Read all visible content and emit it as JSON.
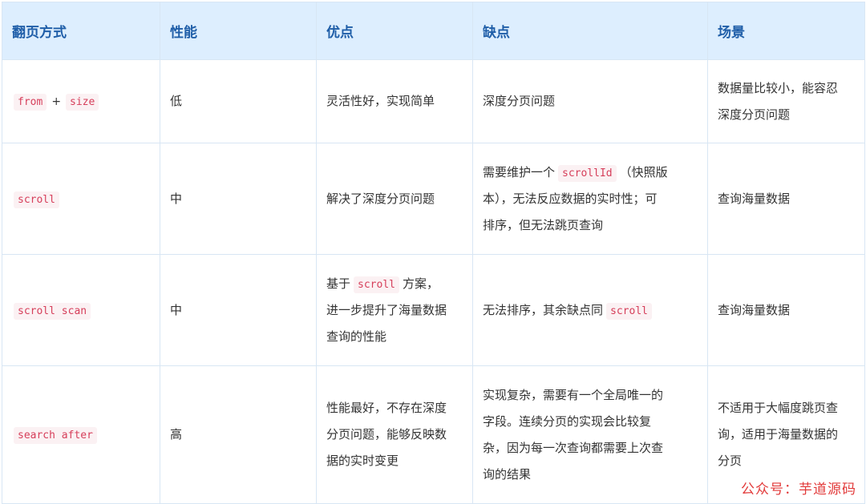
{
  "headers": [
    "翻页方式",
    "性能",
    "优点",
    "缺点",
    "场景"
  ],
  "rows": [
    {
      "method": [
        "from",
        "+",
        "size"
      ],
      "performance": "低",
      "pros": "灵活性好，实现简单",
      "cons": "深度分页问题",
      "scenario_line1": "数据量比较小，能容忍",
      "scenario_line2": "深度分页问题"
    },
    {
      "method": "scroll",
      "performance": "中",
      "pros": "解决了深度分页问题",
      "cons_line1_pre": "需要维护一个",
      "cons_code": "scrollId",
      "cons_line1_post": "（快照版",
      "cons_line2": "本），无法反应数据的实时性；可",
      "cons_line3": "排序，但无法跳页查询",
      "scenario": "查询海量数据"
    },
    {
      "method": "scroll scan",
      "performance": "中",
      "pros_pre": "基于",
      "pros_code": "scroll",
      "pros_post": "方案，",
      "pros_line2": "进一步提升了海量数据",
      "pros_line3": "查询的性能",
      "cons_pre": "无法排序，其余缺点同",
      "cons_code": "scroll",
      "scenario": "查询海量数据"
    },
    {
      "method": "search after",
      "performance": "高",
      "pros_line1": "性能最好，不存在深度",
      "pros_line2": "分页问题，能够反映数",
      "pros_line3": "据的实时变更",
      "cons_line1": "实现复杂，需要有一个全局唯一的",
      "cons_line2": "字段。连续分页的实现会比较复",
      "cons_line3": "杂，因为每一次查询都需要上次查",
      "cons_line4": "询的结果",
      "scenario_line1": "不适用于大幅度跳页查",
      "scenario_line2": "询，适用于海量数据的",
      "scenario_line3": "分页"
    }
  ],
  "watermark": "公众号：芋道源码",
  "colors": {
    "header_bg": "#ddeefe",
    "header_text": "#1f5ea8",
    "code_text": "#d63e5a",
    "code_bg": "#fbf1f3",
    "border": "#d8e6f4",
    "watermark": "#e23a3a"
  }
}
